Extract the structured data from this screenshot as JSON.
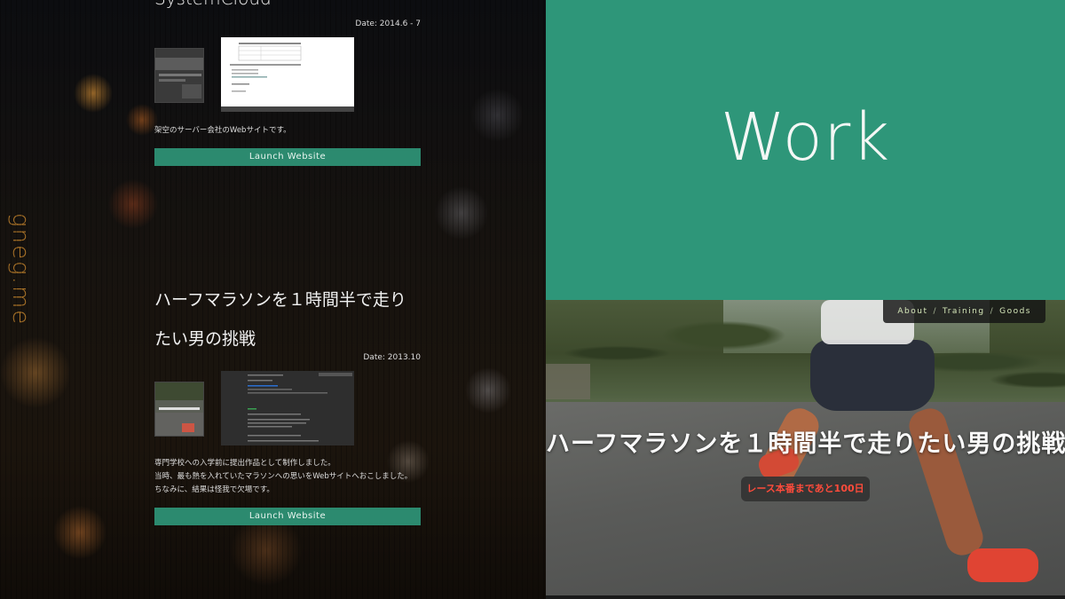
{
  "left_panel": {
    "vertical_logo": "gneg.me",
    "projects": [
      {
        "title": "SystemCloud",
        "date": "Date: 2014.6 - 7",
        "description_lines": [
          "架空のサーバー会社のWebサイトです。"
        ],
        "launch_label": "Launch Website"
      },
      {
        "title": "ハーフマラソンを１時間半で走りたい男の挑戦",
        "date": "Date: 2013.10",
        "description_lines": [
          "専門学校への入学前に提出作品として制作しました。",
          "当時、最も熱を入れていたマラソンへの思いをWebサイトへおこしました。",
          "ちなみに、結果は怪我で欠場です。"
        ],
        "launch_label": "Launch Website"
      }
    ]
  },
  "right_panel": {
    "section_title": "Work",
    "accent_color": "#2e9679",
    "site_preview": {
      "nav": [
        "About",
        "Training",
        "Goods"
      ],
      "nav_separator": "/",
      "heading": "ハーフマラソンを１時間半で走りたい男の挑戦",
      "countdown": "レース本番まであと100日"
    }
  }
}
